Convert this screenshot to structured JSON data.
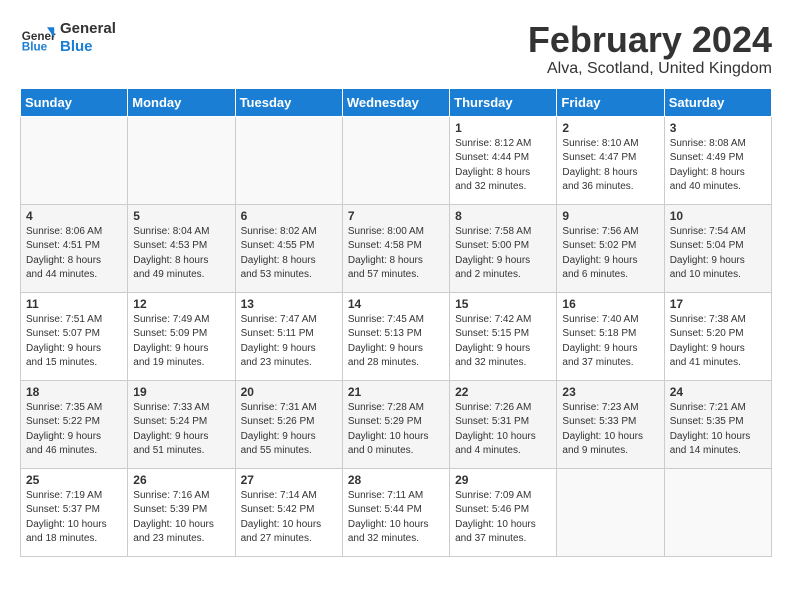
{
  "header": {
    "logo_line1": "General",
    "logo_line2": "Blue",
    "title": "February 2024",
    "subtitle": "Alva, Scotland, United Kingdom"
  },
  "weekdays": [
    "Sunday",
    "Monday",
    "Tuesday",
    "Wednesday",
    "Thursday",
    "Friday",
    "Saturday"
  ],
  "weeks": [
    [
      {
        "day": "",
        "info": ""
      },
      {
        "day": "",
        "info": ""
      },
      {
        "day": "",
        "info": ""
      },
      {
        "day": "",
        "info": ""
      },
      {
        "day": "1",
        "info": "Sunrise: 8:12 AM\nSunset: 4:44 PM\nDaylight: 8 hours\nand 32 minutes."
      },
      {
        "day": "2",
        "info": "Sunrise: 8:10 AM\nSunset: 4:47 PM\nDaylight: 8 hours\nand 36 minutes."
      },
      {
        "day": "3",
        "info": "Sunrise: 8:08 AM\nSunset: 4:49 PM\nDaylight: 8 hours\nand 40 minutes."
      }
    ],
    [
      {
        "day": "4",
        "info": "Sunrise: 8:06 AM\nSunset: 4:51 PM\nDaylight: 8 hours\nand 44 minutes."
      },
      {
        "day": "5",
        "info": "Sunrise: 8:04 AM\nSunset: 4:53 PM\nDaylight: 8 hours\nand 49 minutes."
      },
      {
        "day": "6",
        "info": "Sunrise: 8:02 AM\nSunset: 4:55 PM\nDaylight: 8 hours\nand 53 minutes."
      },
      {
        "day": "7",
        "info": "Sunrise: 8:00 AM\nSunset: 4:58 PM\nDaylight: 8 hours\nand 57 minutes."
      },
      {
        "day": "8",
        "info": "Sunrise: 7:58 AM\nSunset: 5:00 PM\nDaylight: 9 hours\nand 2 minutes."
      },
      {
        "day": "9",
        "info": "Sunrise: 7:56 AM\nSunset: 5:02 PM\nDaylight: 9 hours\nand 6 minutes."
      },
      {
        "day": "10",
        "info": "Sunrise: 7:54 AM\nSunset: 5:04 PM\nDaylight: 9 hours\nand 10 minutes."
      }
    ],
    [
      {
        "day": "11",
        "info": "Sunrise: 7:51 AM\nSunset: 5:07 PM\nDaylight: 9 hours\nand 15 minutes."
      },
      {
        "day": "12",
        "info": "Sunrise: 7:49 AM\nSunset: 5:09 PM\nDaylight: 9 hours\nand 19 minutes."
      },
      {
        "day": "13",
        "info": "Sunrise: 7:47 AM\nSunset: 5:11 PM\nDaylight: 9 hours\nand 23 minutes."
      },
      {
        "day": "14",
        "info": "Sunrise: 7:45 AM\nSunset: 5:13 PM\nDaylight: 9 hours\nand 28 minutes."
      },
      {
        "day": "15",
        "info": "Sunrise: 7:42 AM\nSunset: 5:15 PM\nDaylight: 9 hours\nand 32 minutes."
      },
      {
        "day": "16",
        "info": "Sunrise: 7:40 AM\nSunset: 5:18 PM\nDaylight: 9 hours\nand 37 minutes."
      },
      {
        "day": "17",
        "info": "Sunrise: 7:38 AM\nSunset: 5:20 PM\nDaylight: 9 hours\nand 41 minutes."
      }
    ],
    [
      {
        "day": "18",
        "info": "Sunrise: 7:35 AM\nSunset: 5:22 PM\nDaylight: 9 hours\nand 46 minutes."
      },
      {
        "day": "19",
        "info": "Sunrise: 7:33 AM\nSunset: 5:24 PM\nDaylight: 9 hours\nand 51 minutes."
      },
      {
        "day": "20",
        "info": "Sunrise: 7:31 AM\nSunset: 5:26 PM\nDaylight: 9 hours\nand 55 minutes."
      },
      {
        "day": "21",
        "info": "Sunrise: 7:28 AM\nSunset: 5:29 PM\nDaylight: 10 hours\nand 0 minutes."
      },
      {
        "day": "22",
        "info": "Sunrise: 7:26 AM\nSunset: 5:31 PM\nDaylight: 10 hours\nand 4 minutes."
      },
      {
        "day": "23",
        "info": "Sunrise: 7:23 AM\nSunset: 5:33 PM\nDaylight: 10 hours\nand 9 minutes."
      },
      {
        "day": "24",
        "info": "Sunrise: 7:21 AM\nSunset: 5:35 PM\nDaylight: 10 hours\nand 14 minutes."
      }
    ],
    [
      {
        "day": "25",
        "info": "Sunrise: 7:19 AM\nSunset: 5:37 PM\nDaylight: 10 hours\nand 18 minutes."
      },
      {
        "day": "26",
        "info": "Sunrise: 7:16 AM\nSunset: 5:39 PM\nDaylight: 10 hours\nand 23 minutes."
      },
      {
        "day": "27",
        "info": "Sunrise: 7:14 AM\nSunset: 5:42 PM\nDaylight: 10 hours\nand 27 minutes."
      },
      {
        "day": "28",
        "info": "Sunrise: 7:11 AM\nSunset: 5:44 PM\nDaylight: 10 hours\nand 32 minutes."
      },
      {
        "day": "29",
        "info": "Sunrise: 7:09 AM\nSunset: 5:46 PM\nDaylight: 10 hours\nand 37 minutes."
      },
      {
        "day": "",
        "info": ""
      },
      {
        "day": "",
        "info": ""
      }
    ]
  ]
}
